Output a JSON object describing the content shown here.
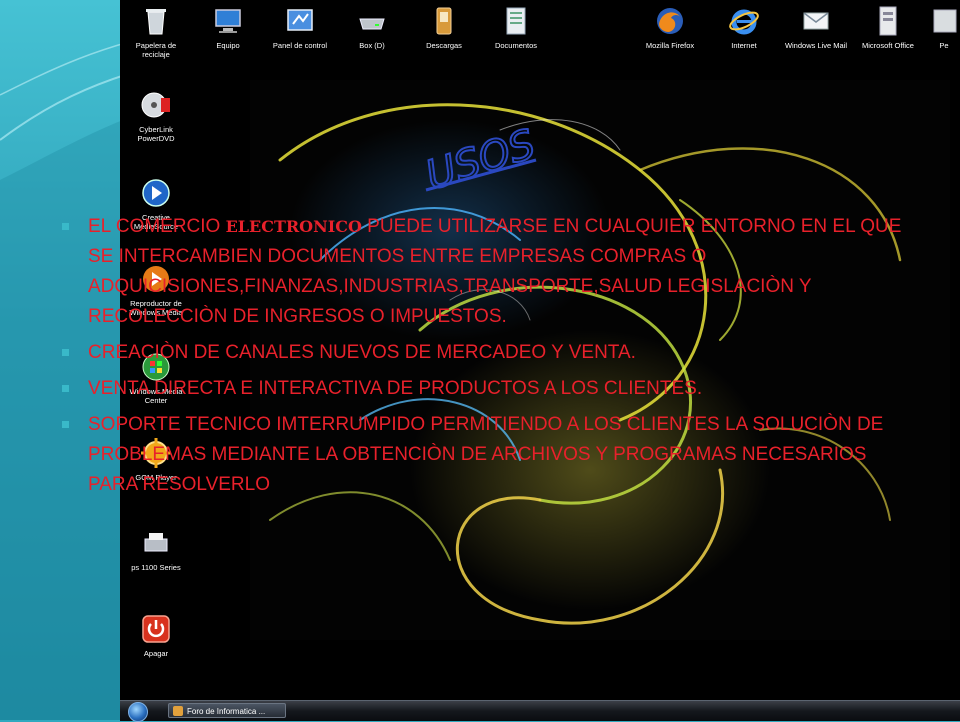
{
  "slide": {
    "heading": "USOS",
    "bullets": [
      {
        "pre": "EL COMERCIO ",
        "em": "ELECTRONICO",
        "post": " PUEDE UTILIZARSE EN CUALQUIER ENTORNO EN EL QUE SE INTERCAMBIEN DOCUMENTOS ENTRE EMPRESAS COMPRAS O ADQUICISIONES,FINANZAS,INDUSTRIAS,TRANSPORTE,SALUD LEGISLACIÒN Y RECOLECCIÒN DE INGRESOS O IMPUESTOS."
      },
      {
        "text": "CREACIÒN DE CANALES NUEVOS DE MERCADEO Y VENTA."
      },
      {
        "text": "VENTA DIRECTA E INTERACTIVA DE PRODUCTOS A LOS CLIENTES."
      },
      {
        "text": "SOPORTE TECNICO IMTERRUMPIDO PERMITIENDO A LOS CLIENTES LA SOLUCIÒN DE PROBLEMAS MEDIANTE LA OBTENCIÒN DE ARCHIVOS Y PROGRAMAS NECESARIOS PARA RESOLVERLO"
      }
    ],
    "colors": {
      "text": "#e8212b",
      "bullet": "#39b9c9",
      "heading": "#1f3ea8"
    }
  },
  "desktop": {
    "top_icons": [
      {
        "label": "Papelera de reciclaje",
        "icon": "recycle-bin-icon"
      },
      {
        "label": "Equipo",
        "icon": "computer-icon"
      },
      {
        "label": "Panel de control",
        "icon": "control-panel-icon"
      },
      {
        "label": "Box (D)",
        "icon": "drive-icon"
      },
      {
        "label": "Descargas",
        "icon": "downloads-icon"
      },
      {
        "label": "Documentos",
        "icon": "documents-icon"
      },
      {
        "label": "Mozilla Firefox",
        "icon": "firefox-icon"
      },
      {
        "label": "Internet",
        "icon": "internet-explorer-icon"
      },
      {
        "label": "Windows Live Mail",
        "icon": "mail-icon"
      },
      {
        "label": "Microsoft Office",
        "icon": "office-icon"
      },
      {
        "label": "Pe",
        "icon": "folder-icon"
      }
    ],
    "side_icons": [
      {
        "label": "CyberLink PowerDVD",
        "icon": "dvd-icon"
      },
      {
        "label": "Creative MediaSource",
        "icon": "media-source-icon"
      },
      {
        "label": "Reproductor de Windows Media",
        "icon": "media-player-icon"
      },
      {
        "label": "Windows Media Center",
        "icon": "media-center-icon"
      },
      {
        "label": "GOM Player",
        "icon": "gom-player-icon"
      },
      {
        "label": "ps 1100 Series",
        "icon": "printer-icon"
      },
      {
        "label": "Apagar",
        "icon": "power-icon"
      }
    ]
  },
  "taskbar": {
    "task_label": "Foro de Informatica ..."
  }
}
